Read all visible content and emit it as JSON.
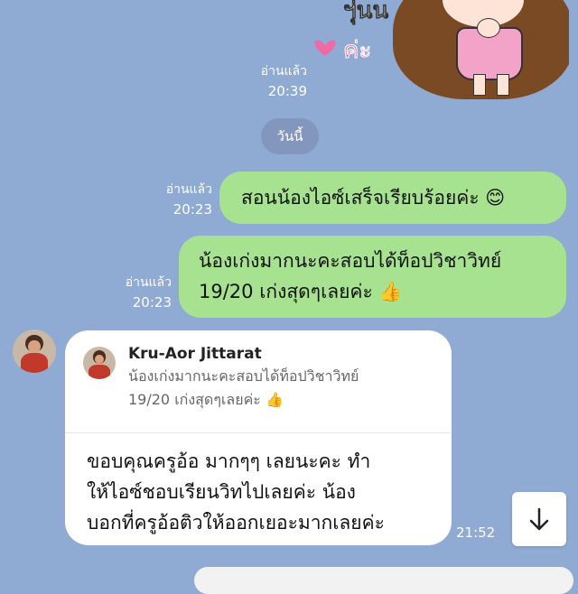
{
  "sticker": {
    "text_line1": "ฯุ่นน",
    "text_line2": "ค่ะ",
    "read_label": "อ่านแล้ว",
    "time": "20:39"
  },
  "date_chip": "วันนี้",
  "messages_out": [
    {
      "read_label": "อ่านแล้ว",
      "time": "20:23",
      "text": "สอนน้องไอซ์เสร็จเรียบร้อยค่ะ 😊"
    },
    {
      "read_label": "อ่านแล้ว",
      "time": "20:23",
      "line1": "น้องเก่งมากนะคะสอบได้ท็อปวิชาวิทย์",
      "line2": "19/20 เก่งสุดๆเลยค่ะ 👍"
    }
  ],
  "message_in": {
    "reply": {
      "name": "Kru-Aor Jittarat",
      "line1": "น้องเก่งมากนะคะสอบได้ท็อปวิชาวิทย์",
      "line2": "19/20 เก่งสุดๆเลยค่ะ 👍"
    },
    "line1": "ขอบคุณครูอ้อ มากๆๆ เลยนะคะ  ทำ",
    "line2": "ให้ไอซ์ชอบเรียนวิทไปเลยค่ะ  น้อง",
    "line3": "บอกที่ครูอ้อติวให้ออกเยอะมากเลยค่ะ",
    "time": "21:52"
  },
  "colors": {
    "background": "#8faad3",
    "outgoing_bubble": "#a6e28f",
    "incoming_bubble": "#ffffff",
    "date_chip": "#8396bd"
  },
  "icons": {
    "scroll_down": "arrow-down-icon"
  }
}
